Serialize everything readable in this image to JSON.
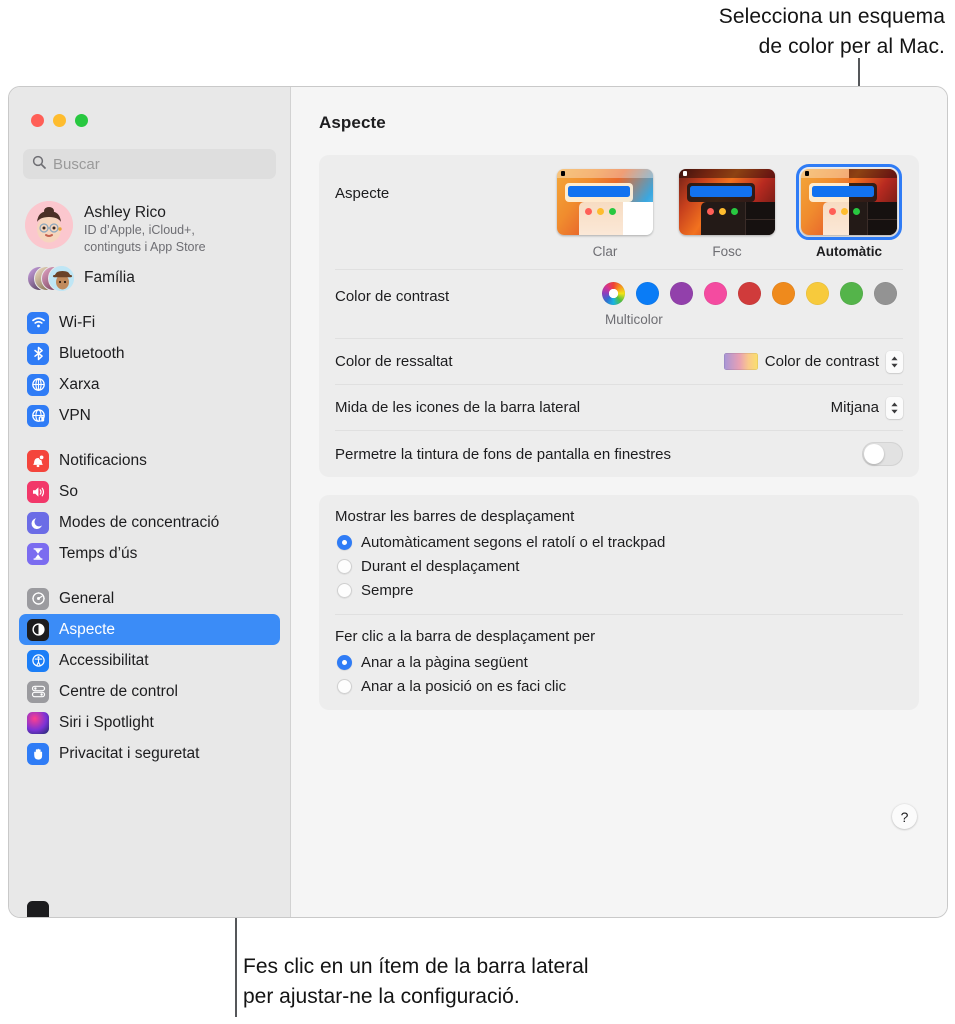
{
  "callouts": {
    "top_line1": "Selecciona un esquema",
    "top_line2": "de color per al Mac.",
    "bottom_line1": "Fes clic en un ítem de la barra lateral",
    "bottom_line2": "per ajustar-ne la configuració."
  },
  "window": {
    "title": "Aspecte"
  },
  "sidebar": {
    "search_placeholder": "Buscar",
    "account": {
      "name": "Ashley Rico",
      "subtitle_line1": "ID d’Apple, iCloud+,",
      "subtitle_line2": "continguts i App Store"
    },
    "family_label": "Família",
    "groups": [
      {
        "items": [
          {
            "label": "Wi-Fi",
            "icon": "wifi-icon",
            "selected": false
          },
          {
            "label": "Bluetooth",
            "icon": "bluetooth-icon",
            "selected": false
          },
          {
            "label": "Xarxa",
            "icon": "network-globe-icon",
            "selected": false
          },
          {
            "label": "VPN",
            "icon": "vpn-globe-icon",
            "selected": false
          }
        ]
      },
      {
        "items": [
          {
            "label": "Notificacions",
            "icon": "bell-icon",
            "selected": false
          },
          {
            "label": "So",
            "icon": "speaker-icon",
            "selected": false
          },
          {
            "label": "Modes de concentració",
            "icon": "moon-icon",
            "selected": false
          },
          {
            "label": "Temps d’ús",
            "icon": "hourglass-icon",
            "selected": false
          }
        ]
      },
      {
        "items": [
          {
            "label": "General",
            "icon": "gear-icon",
            "selected": false
          },
          {
            "label": "Aspecte",
            "icon": "appearance-icon",
            "selected": true
          },
          {
            "label": "Accessibilitat",
            "icon": "accessibility-icon",
            "selected": false
          },
          {
            "label": "Centre de control",
            "icon": "control-center-icon",
            "selected": false
          },
          {
            "label": "Siri i Spotlight",
            "icon": "siri-icon",
            "selected": false
          },
          {
            "label": "Privacitat i seguretat",
            "icon": "hand-privacy-icon",
            "selected": false
          }
        ]
      }
    ]
  },
  "main": {
    "appearance": {
      "label": "Aspecte",
      "options": [
        {
          "caption": "Clar",
          "selected": false
        },
        {
          "caption": "Fosc",
          "selected": false
        },
        {
          "caption": "Automàtic",
          "selected": true
        }
      ]
    },
    "accent": {
      "label": "Color de contrast",
      "caption": "Multicolor",
      "swatches": [
        {
          "name": "multicolor",
          "color": "multicolor",
          "selected": true
        },
        {
          "name": "blue",
          "color": "#0a7cf6"
        },
        {
          "name": "purple",
          "color": "#9240ab"
        },
        {
          "name": "pink",
          "color": "#f44ba0"
        },
        {
          "name": "red",
          "color": "#d03b3b"
        },
        {
          "name": "orange",
          "color": "#ef8a1c"
        },
        {
          "name": "yellow",
          "color": "#f7ca3c"
        },
        {
          "name": "green",
          "color": "#54b44a"
        },
        {
          "name": "graphite",
          "color": "#939393"
        }
      ]
    },
    "highlight": {
      "label": "Color de ressaltat",
      "value": "Color de contrast"
    },
    "sidebar_icon_size": {
      "label": "Mida de les icones de la barra lateral",
      "value": "Mitjana"
    },
    "wallpaper_tint": {
      "label": "Permetre la tintura de fons de pantalla en finestres",
      "enabled": false
    },
    "scrollbars": {
      "title": "Mostrar les barres de desplaçament",
      "options": [
        {
          "label": "Automàticament segons el ratolí o el trackpad",
          "selected": true
        },
        {
          "label": "Durant el desplaçament",
          "selected": false
        },
        {
          "label": "Sempre",
          "selected": false
        }
      ]
    },
    "scroll_click": {
      "title": "Fer clic a la barra de desplaçament per",
      "options": [
        {
          "label": "Anar a la pàgina següent",
          "selected": true
        },
        {
          "label": "Anar a la posició on es faci clic",
          "selected": false
        }
      ]
    },
    "help_label": "?"
  }
}
